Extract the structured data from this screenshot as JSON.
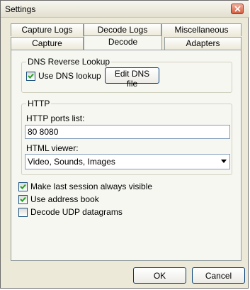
{
  "window": {
    "title": "Settings"
  },
  "tabs": {
    "row1": [
      "Capture Logs",
      "Decode Logs",
      "Miscellaneous"
    ],
    "row2": [
      "Capture",
      "Decode",
      "Adapters"
    ],
    "active": "Decode"
  },
  "dns": {
    "group_label": "DNS Reverse Lookup",
    "use_dns_label": "Use DNS lookup",
    "use_dns_checked": true,
    "edit_button": "Edit DNS file"
  },
  "http": {
    "group_label": "HTTP",
    "ports_label": "HTTP ports list:",
    "ports_value": "80 8080",
    "viewer_label": "HTML viewer:",
    "viewer_value": "Video, Sounds, Images"
  },
  "options": [
    {
      "label": "Make last session always visible",
      "checked": true
    },
    {
      "label": "Use address book",
      "checked": true
    },
    {
      "label": "Decode UDP datagrams",
      "checked": false
    }
  ],
  "buttons": {
    "ok": "OK",
    "cancel": "Cancel"
  }
}
